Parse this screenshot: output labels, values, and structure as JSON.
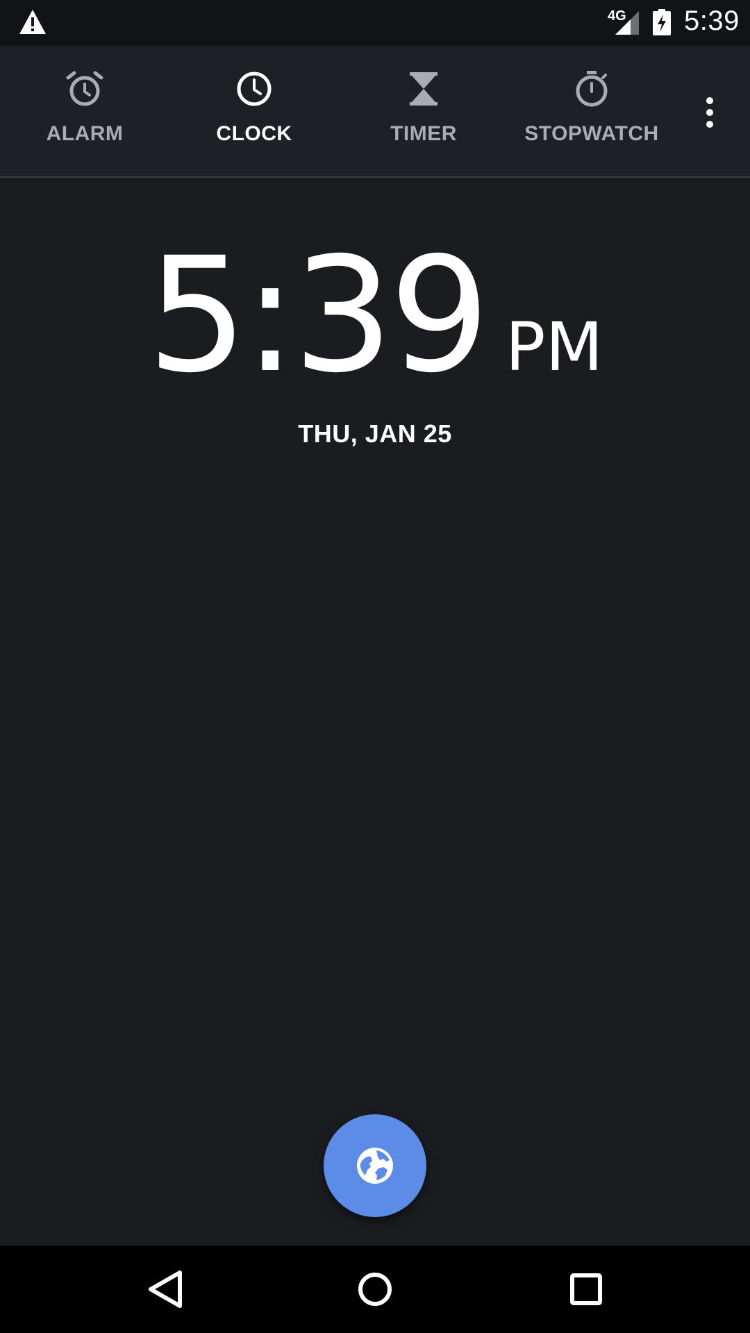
{
  "status_bar": {
    "network_type": "4G",
    "time": "5:39",
    "icons": [
      "warning-icon",
      "signal-icon",
      "battery-charging-icon"
    ]
  },
  "tabs": [
    {
      "label": "ALARM",
      "icon": "alarm-clock-icon",
      "active": false
    },
    {
      "label": "CLOCK",
      "icon": "clock-icon",
      "active": true
    },
    {
      "label": "TIMER",
      "icon": "hourglass-icon",
      "active": false
    },
    {
      "label": "STOPWATCH",
      "icon": "stopwatch-icon",
      "active": false
    }
  ],
  "overflow_icon": "more-vert-icon",
  "clock": {
    "time": "5:39",
    "ampm": "PM",
    "date": "THU, JAN 25"
  },
  "fab": {
    "icon": "globe-icon"
  },
  "nav_bar": {
    "icons": [
      "back-icon",
      "home-icon",
      "recents-icon"
    ]
  },
  "colors": {
    "background": "#1a1c20",
    "tab_bar": "#1d2024",
    "fab": "#5b8de8",
    "inactive_tab_text": "#a9adb2",
    "active_tab_text": "#ffffff"
  }
}
